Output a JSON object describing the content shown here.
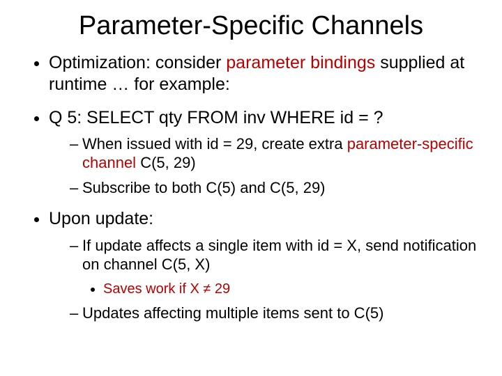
{
  "title": "Parameter-Specific Channels",
  "bullets": {
    "b1_pre": "Optimization: consider ",
    "b1_red": "parameter bindings",
    "b1_post": " supplied at runtime … for example:",
    "b2": "Q 5: SELECT qty FROM inv WHERE id = ?",
    "b2_s1_pre": "When issued with id = 29, create extra ",
    "b2_s1_red": "parameter-specific channel",
    "b2_s1_post": " C(5, 29)",
    "b2_s2": "Subscribe to both C(5) and C(5, 29)",
    "b3": "Upon update:",
    "b3_s1": "If update affects a single item with id = X, send notification on channel C(5, X)",
    "b3_s1_a_red": "Saves work if X ≠ 29",
    "b3_s2": "Updates affecting multiple items sent to C(5)"
  }
}
